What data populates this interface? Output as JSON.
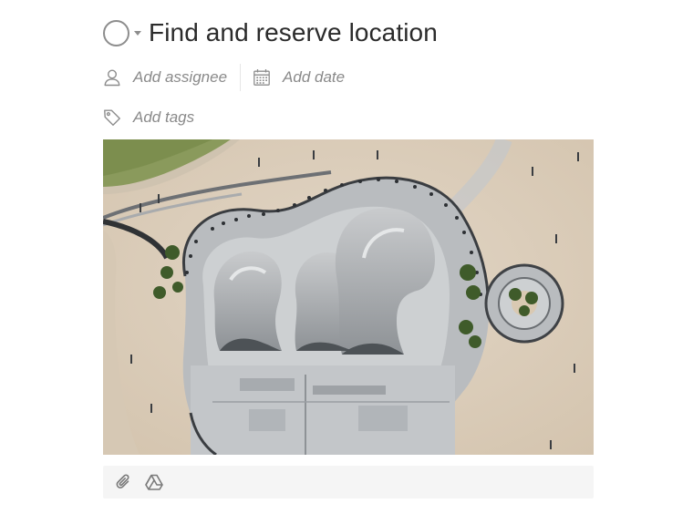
{
  "task": {
    "title": "Find and reserve location",
    "status_icon": "circle-outline-icon"
  },
  "meta": {
    "assignee_label": "Add assignee",
    "assignee_icon": "user-icon",
    "date_label": "Add date",
    "date_icon": "calendar-icon",
    "tags_label": "Add tags",
    "tags_icon": "tag-icon"
  },
  "attachment": {
    "kind": "image",
    "subject": "aerial view of a skate park on a beach"
  },
  "toolbar": {
    "icons": [
      "paperclip-icon",
      "google-drive-icon"
    ]
  },
  "colors": {
    "icon_gray": "#8d8d8d",
    "text": "#2b2b2b",
    "placeholder": "#8a8a8a",
    "toolbar_bg": "#f5f5f5"
  }
}
